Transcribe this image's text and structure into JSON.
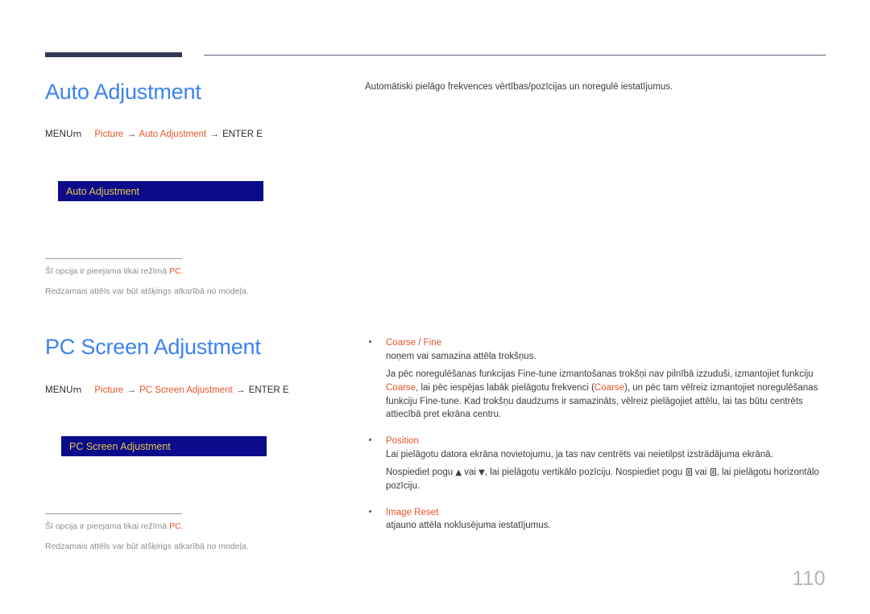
{
  "page": {
    "number": "110"
  },
  "sections": [
    {
      "title": "Auto Adjustment",
      "menu_path": {
        "menu_label": "MENU",
        "keycap": "m",
        "item1": "Picture",
        "arrow1": "→",
        "item2": "Auto Adjustment",
        "arrow2": "→",
        "enter_label": "ENTER",
        "enter_keycap": "E"
      },
      "osd_label": "Auto Adjustment",
      "footnotes": [
        {
          "prefix": "Šī opcija ir pieejama tikai režīmā ",
          "highlight": "PC",
          "suffix": "."
        },
        {
          "prefix": "Redzamais attēls var būt atšķirigs atkarībā no modeļa.",
          "highlight": "",
          "suffix": ""
        }
      ],
      "intro": "Automātiski pielāgo frekvences vērtības/pozīcijas un noregulē iestatījumus."
    },
    {
      "title": "PC Screen Adjustment",
      "menu_path": {
        "menu_label": "MENU",
        "keycap": "m",
        "item1": "Picture",
        "arrow1": "→",
        "item2": "PC Screen Adjustment",
        "arrow2": "→",
        "enter_label": "ENTER",
        "enter_keycap": "E"
      },
      "osd_label": "PC Screen Adjustment",
      "footnotes": [
        {
          "prefix": "Šī opcija ir pieejama tikai režīmā ",
          "highlight": "PC",
          "suffix": "."
        },
        {
          "prefix": "Redzamais attēls var būt atšķirigs atkarībā no modeļa.",
          "highlight": "",
          "suffix": ""
        }
      ]
    }
  ],
  "bullets": {
    "coarse_fine": {
      "title_a": "Coarse",
      "title_sep": " / ",
      "title_b": "Fine",
      "line1": "noņem vai samazina attēla trokšņus.",
      "para_part1": "Ja pēc noregulēšanas funkcijas Fine-tune izmantošanas trokšņi nav pilnībā izzuduši, izmantojiet funkciju ",
      "para_hi1": "Coarse",
      "para_part2": ", lai pēc iespējas labāk pielāgotu frekvenci (",
      "para_hi2": "Coarse",
      "para_part3": "), un pēc tam vēlreiz izmantojiet noregulēšanas funkciju Fine-tune. Kad trokšņu daudzums ir samazināts, vēlreiz pielāgojiet attēlu, lai tas būtu centrēts attiecībā pret ekrāna centru."
    },
    "position": {
      "title": "Position",
      "line1": "Lai pielāgotu datora ekrāna novietojumu, ja tas nav centrēts vai neietilpst izstrādājuma ekrānā.",
      "para_part1": "Nospiediet pogu ",
      "up_arrow": "▲",
      "para_part2": " vai ",
      "down_arrow": "▼",
      "para_part3": ", lai pielāgotu vertikālo pozīciju. Nospiediet pogu ",
      "para_part4": " vai ",
      "para_part5": ", lai pielāgotu horizontālo pozīciju."
    },
    "image_reset": {
      "title": "Image Reset",
      "line1": "atjauno attēla noklusējuma iestatījumus."
    }
  },
  "colors": {
    "heading_blue": "#3b82f0",
    "accent_orange": "#e8532a",
    "osd_bg": "#0b0b8c",
    "osd_text": "#e8c84a",
    "rule_navy": "#2e3856",
    "footnote_gray": "#8e8e8e",
    "page_number_gray": "#b5b5b5"
  }
}
